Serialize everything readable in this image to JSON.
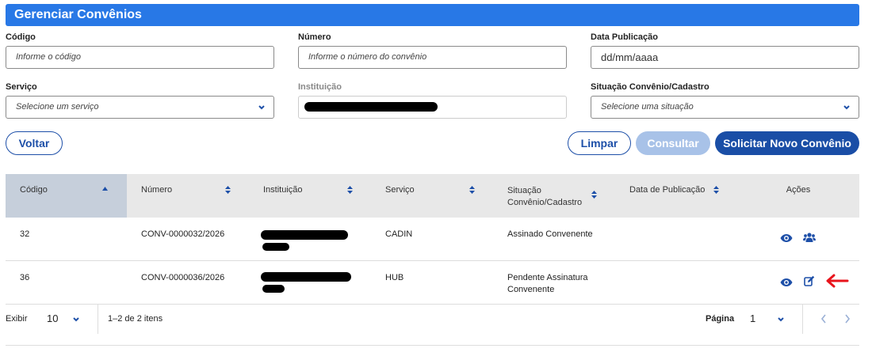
{
  "page": {
    "title": "Gerenciar Convênios"
  },
  "filters": {
    "codigo": {
      "label": "Código",
      "placeholder": "Informe o código"
    },
    "numero": {
      "label": "Número",
      "placeholder": "Informe o número do convênio"
    },
    "data_publicacao": {
      "label": "Data Publicação",
      "placeholder": "dd/mm/aaaa"
    },
    "servico": {
      "label": "Serviço",
      "placeholder": "Selecione um serviço"
    },
    "instituicao": {
      "label": "Instituição"
    },
    "situacao": {
      "label": "Situação Convênio/Cadastro",
      "placeholder": "Selecione uma situação"
    }
  },
  "buttons": {
    "voltar": "Voltar",
    "limpar": "Limpar",
    "consultar": "Consultar",
    "solicitar": "Solicitar Novo Convênio"
  },
  "table": {
    "headers": {
      "codigo": "Código",
      "numero": "Número",
      "instituicao": "Instituição",
      "servico": "Serviço",
      "situacao_1": "Situação",
      "situacao_2": "Convênio/Cadastro",
      "data_publicacao": "Data de Publicação",
      "acoes": "Ações"
    },
    "rows": [
      {
        "codigo": "32",
        "numero": "CONV-0000032/2026",
        "servico": "CADIN",
        "situacao_1": "Assinado Convenente",
        "situacao_2": "",
        "data_publicacao": ""
      },
      {
        "codigo": "36",
        "numero": "CONV-0000036/2026",
        "servico": "HUB",
        "situacao_1": "Pendente Assinatura",
        "situacao_2": "Convenente",
        "data_publicacao": ""
      }
    ]
  },
  "pagination": {
    "exibir_label": "Exibir",
    "page_size": "10",
    "range_text": "1–2 de 2 itens",
    "pagina_label": "Página",
    "current_page": "1"
  },
  "icons": [
    "view-icon",
    "users-icon",
    "edit-icon",
    "red-arrow-icon",
    "chevron-down-icon",
    "sort-icon",
    "sort-asc-icon",
    "chevron-left-icon",
    "chevron-right-icon"
  ],
  "colors": {
    "header": "#2878e6",
    "primary": "#1a4ea6",
    "disabled": "#a8c2e8",
    "annotation": "#e8141c"
  }
}
